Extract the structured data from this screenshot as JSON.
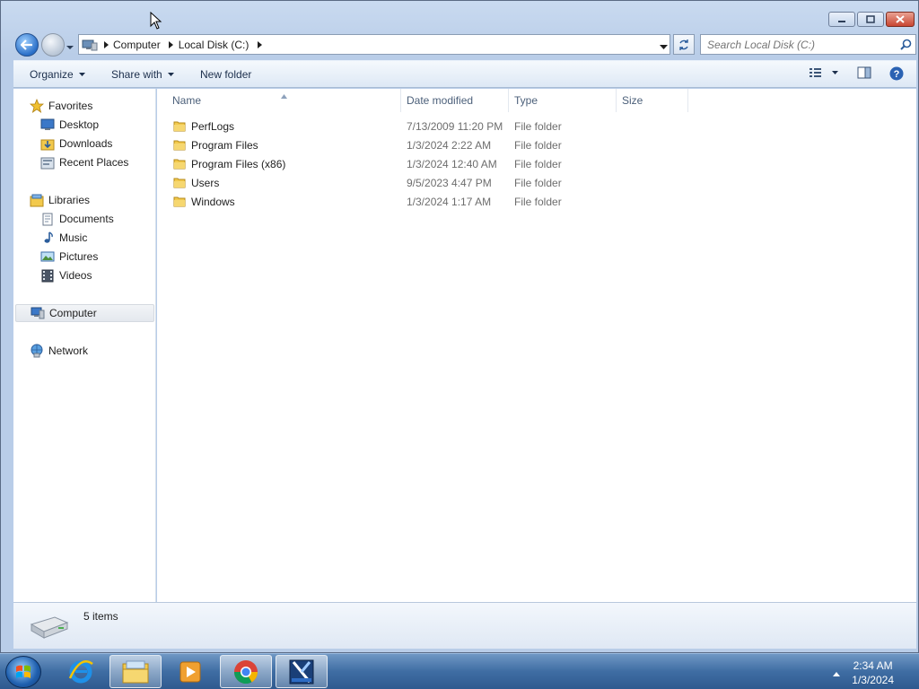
{
  "address": {
    "crumbs": [
      "Computer",
      "Local Disk (C:)"
    ],
    "search_placeholder": "Search Local Disk (C:)"
  },
  "toolbar": {
    "organize": "Organize",
    "share_with": "Share with",
    "new_folder": "New folder"
  },
  "nav": {
    "favorites": "Favorites",
    "desktop": "Desktop",
    "downloads": "Downloads",
    "recent_places": "Recent Places",
    "libraries": "Libraries",
    "documents": "Documents",
    "music": "Music",
    "pictures": "Pictures",
    "videos": "Videos",
    "computer": "Computer",
    "network": "Network"
  },
  "columns": {
    "name": "Name",
    "date_modified": "Date modified",
    "type": "Type",
    "size": "Size"
  },
  "files": [
    {
      "name": "PerfLogs",
      "date": "7/13/2009 11:20 PM",
      "type": "File folder"
    },
    {
      "name": "Program Files",
      "date": "1/3/2024 2:22 AM",
      "type": "File folder"
    },
    {
      "name": "Program Files (x86)",
      "date": "1/3/2024 12:40 AM",
      "type": "File folder"
    },
    {
      "name": "Users",
      "date": "9/5/2023 4:47 PM",
      "type": "File folder"
    },
    {
      "name": "Windows",
      "date": "1/3/2024 1:17 AM",
      "type": "File folder"
    }
  ],
  "details": {
    "item_count": "5 items"
  },
  "taskbar": {
    "apps": [
      "internet-explorer",
      "windows-explorer",
      "media-player",
      "chrome",
      "video-editor"
    ],
    "clock_time": "2:34 AM",
    "clock_date": "1/3/2024"
  },
  "colors": {
    "window_frame": "#c9daf0",
    "folder_yellow": "#f2c94c",
    "taskbar": "#3f6da3"
  }
}
